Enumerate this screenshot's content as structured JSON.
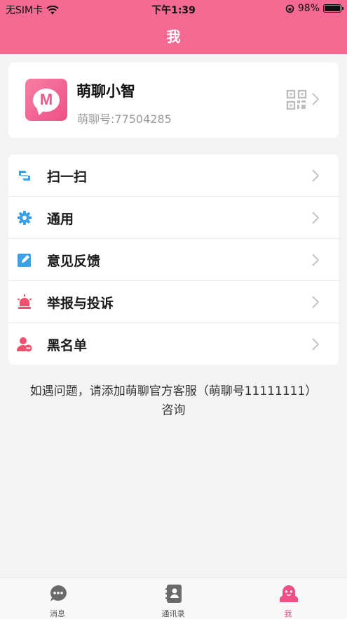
{
  "status_bar": {
    "carrier": "无SIM卡",
    "time": "下午1:39",
    "battery": "98%",
    "battery_level": 0.98
  },
  "nav": {
    "title": "我"
  },
  "profile": {
    "name": "萌聊小智",
    "id_text": "萌聊号:77504285",
    "avatar_letter": "M",
    "avatar_icon": "m-chat-bubble-logo",
    "qr_icon": "qr-code-icon"
  },
  "menu": {
    "items": [
      {
        "label": "扫一扫",
        "icon": "scan-icon",
        "color": "#3aa0e8"
      },
      {
        "label": "通用",
        "icon": "gear-icon",
        "color": "#3aa0e8"
      },
      {
        "label": "意见反馈",
        "icon": "edit-icon",
        "color": "#3aa0e8"
      },
      {
        "label": "举报与投诉",
        "icon": "alarm-icon",
        "color": "#f0506e"
      },
      {
        "label": "黑名单",
        "icon": "blocked-user-icon",
        "color": "#f0506e"
      }
    ]
  },
  "help": {
    "line1": "如遇问题，请添加萌聊官方客服（萌聊号11111111）",
    "line2": "咨询"
  },
  "tabbar": {
    "tabs": [
      {
        "label": "消息",
        "icon": "chat-icon",
        "active": false
      },
      {
        "label": "通讯录",
        "icon": "contacts-icon",
        "active": false
      },
      {
        "label": "我",
        "icon": "ghost-user-icon",
        "active": true
      }
    ]
  },
  "colors": {
    "brand": "#f46a93",
    "active_tab": "#ee4f84",
    "background": "#f4f4f4"
  }
}
